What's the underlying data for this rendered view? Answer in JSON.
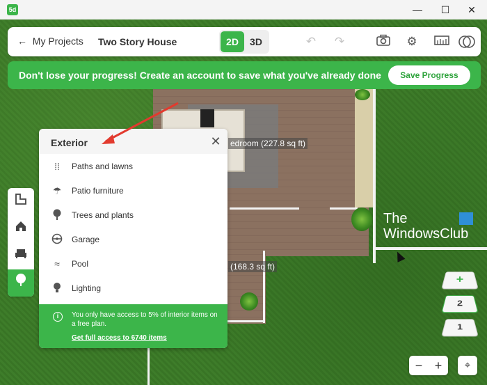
{
  "window": {
    "app_icon_text": "5d",
    "controls": {
      "minimize": "—",
      "maximize": "☐",
      "close": "✕"
    }
  },
  "toolbar": {
    "back_label": "My Projects",
    "project_name": "Two Story House",
    "mode_2d": "2D",
    "mode_3d": "3D",
    "active_mode": "2D",
    "icons": [
      "undo-icon",
      "redo-icon",
      "camera-icon",
      "settings-icon",
      "ruler-icon",
      "help-icon"
    ]
  },
  "banner": {
    "message": "Don't lose your progress! Create an account to save what you've already done",
    "button_label": "Save Progress"
  },
  "side_toolbar": {
    "items": [
      {
        "icon": "floorplan-icon",
        "active": false
      },
      {
        "icon": "house-icon",
        "active": false
      },
      {
        "icon": "sofa-icon",
        "active": false
      },
      {
        "icon": "tree-icon",
        "active": true
      }
    ]
  },
  "panel": {
    "title": "Exterior",
    "close": "✕",
    "items": [
      {
        "label": "Paths and lawns",
        "icon": "path-icon"
      },
      {
        "label": "Patio furniture",
        "icon": "umbrella-icon"
      },
      {
        "label": "Trees and plants",
        "icon": "tree-icon"
      },
      {
        "label": "Garage",
        "icon": "steering-wheel-icon"
      },
      {
        "label": "Pool",
        "icon": "water-wave-icon"
      },
      {
        "label": "Lighting",
        "icon": "bulb-icon"
      }
    ],
    "footer": {
      "info": "You only have access to 5% of interior items on a free plan.",
      "link": "Get full access to 6740 items"
    }
  },
  "plan": {
    "room_labels": [
      "edroom (227.8 sq ft)",
      "(168.3 sq ft)"
    ]
  },
  "watermark": {
    "line1": "The",
    "line2": "WindowsClub"
  },
  "levels": {
    "add": "+",
    "level2": "2",
    "level1": "1",
    "current": 2
  },
  "zoom": {
    "minus": "−",
    "plus": "+"
  },
  "colors": {
    "accent": "#3cb54a",
    "grass": "#3e7d2a",
    "floor": "#8b7160"
  }
}
